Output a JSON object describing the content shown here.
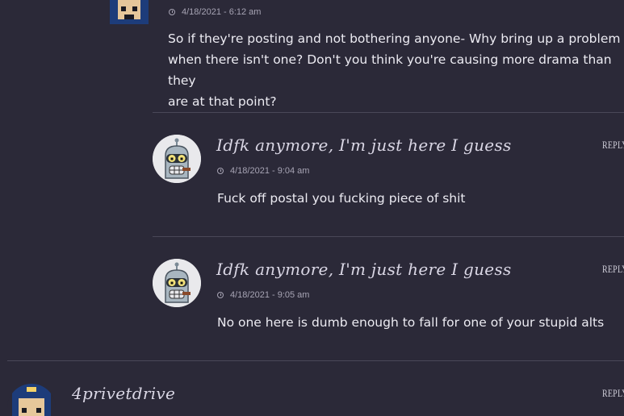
{
  "thread": {
    "top_comment": {
      "timestamp": "4/18/2021 - 6:12 am",
      "lines": [
        "So if they're posting and not bothering anyone- Why bring up a problem",
        "when there isn't one? Don't you think you're causing more drama than they",
        "are at that point?"
      ]
    },
    "replies": [
      {
        "author": "Idfk anymore, I'm just here I guess",
        "timestamp": "4/18/2021 - 9:04 am",
        "text": "Fuck off postal you fucking piece of shit",
        "reply_label": "REPLY",
        "avatar_icon": "robot-avatar-icon"
      },
      {
        "author": "Idfk anymore, I'm just here I guess",
        "timestamp": "4/18/2021 - 9:05 am",
        "text": "No one here is dumb enough to fall for one of your stupid alts",
        "reply_label": "REPLY",
        "avatar_icon": "robot-avatar-icon"
      }
    ],
    "next_comment": {
      "author": "4privetdrive",
      "reply_label": "REPLY",
      "avatar_icon": "pixel-character-avatar-icon"
    }
  },
  "colors": {
    "background": "#2b2938",
    "text": "#ecebf2",
    "meta": "#a7a4b4",
    "divider": "#4a4858"
  }
}
